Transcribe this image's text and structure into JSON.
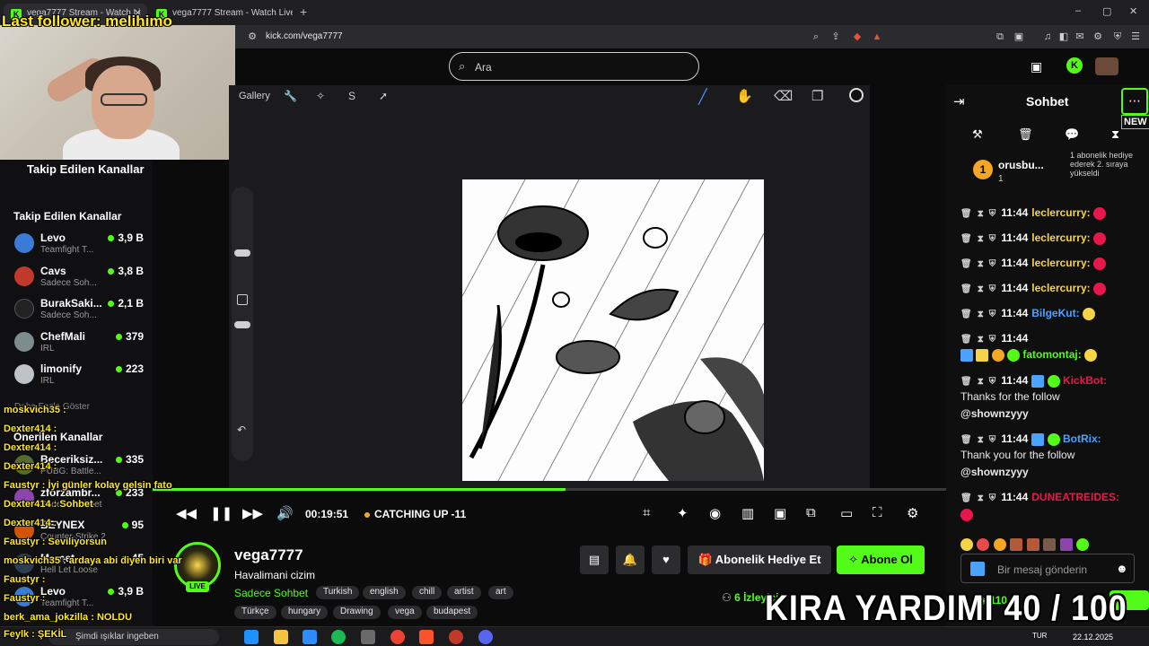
{
  "browser": {
    "tabs": [
      {
        "label": "vega7777 Stream - Watch Li"
      },
      {
        "label": "vega7777 Stream - Watch Live on Ki"
      }
    ],
    "new_tab": "+",
    "url": "kick.com/vega7777",
    "window_controls": [
      "–",
      "▢",
      "✕"
    ]
  },
  "overlay": {
    "last_follower": "Last follower: melihimo",
    "kira": "KIRA YARDIMI  40 / 100",
    "chat": [
      {
        "user": "moskvich35 :",
        "text": "",
        "color": "#ffe81f"
      },
      {
        "user": "Dexter414 :",
        "text": "",
        "color": "#ffe81f"
      },
      {
        "user": "Dexter414 :",
        "text": "",
        "color": "#ffe81f"
      },
      {
        "user": "Dexter414 :",
        "text": "",
        "color": "#ffe81f"
      },
      {
        "user": "Faustyr :",
        "text": "İyi günler kolay gelsin fato",
        "color": "#ffe81f"
      },
      {
        "user": "Dexter414 :",
        "text": "Sohbet",
        "color": "#ffe81f"
      },
      {
        "user": "Dexter414 :",
        "text": "",
        "color": "#ffe81f"
      },
      {
        "user": "Faustyr :",
        "text": "Seviliyorsun",
        "color": "#ffe81f"
      },
      {
        "user": "moskvich35 :",
        "text": "ardaya abi diyen biri var",
        "color": "#ffe81f"
      },
      {
        "user": "Faustyr :",
        "text": "",
        "color": "#ffe81f"
      },
      {
        "user": "Faustyr :",
        "text": "",
        "color": "#ffe81f"
      },
      {
        "user": "berk_ama_jokzilla :",
        "text": "NOLDU",
        "color": "#ffe81f"
      },
      {
        "user": "Feylk :",
        "text": "ŞEKİL",
        "color": "#ffe81f"
      }
    ]
  },
  "sidebar": {
    "heading_followed_top": "Takip Edilen Kanallar",
    "heading_followed": "Takip Edilen Kanallar",
    "heading_recommended": "Önerilen Kanallar",
    "show_more": "Daha Fazla Göster",
    "followed": [
      {
        "name": "Levo",
        "sub": "Teamfight T...",
        "viewers": "3,9 B",
        "color": "#3a7bd5"
      },
      {
        "name": "Cavs",
        "sub": "Sadece Soh...",
        "viewers": "3,8 B",
        "color": "#c0392b"
      },
      {
        "name": "BurakSaki...",
        "sub": "Sadece Soh...",
        "viewers": "2,1 B",
        "color": "#222222"
      },
      {
        "name": "ChefMali",
        "sub": "IRL",
        "viewers": "379",
        "color": "#7f8c8d"
      },
      {
        "name": "limonify",
        "sub": "IRL",
        "viewers": "223",
        "color": "#bdc3c7"
      }
    ],
    "recommended": [
      {
        "name": "Beceriksiz...",
        "sub": "PUBG: Battle...",
        "viewers": "335"
      },
      {
        "name": "zforzambr...",
        "sub": "Sadece Sohbet",
        "viewers": "233"
      },
      {
        "name": "BEYNEX",
        "sub": "Counter-Strike 2",
        "viewers": "95"
      },
      {
        "name": "Memet",
        "sub": "Hell Let Loose",
        "viewers": "45"
      },
      {
        "name": "Levo",
        "sub": "Teamfight T...",
        "viewers": "3,9 B"
      }
    ]
  },
  "header": {
    "search_placeholder": "Ara"
  },
  "player": {
    "gallery": "Gallery",
    "time": "00:19:51",
    "status": "CATCHING UP -11",
    "progress": 0.52
  },
  "stream": {
    "streamer": "vega7777",
    "live": "LIVE",
    "title": "Havalimani cizim",
    "category": "Sadece Sohbet",
    "tags_row1": [
      "Turkish",
      "english",
      "chill",
      "artist",
      "art"
    ],
    "tags_row2": [
      "Türkçe",
      "hungary",
      "Drawing",
      "vega",
      "budapest"
    ],
    "gift_label": "Abonelik Hediye Et",
    "subscribe_label": "Abone Ol",
    "viewers": "6 İzleyici"
  },
  "chat": {
    "title": "Sohbet",
    "new_badge": "NEW",
    "pinned_user": "orusbu...",
    "pinned_count": "1",
    "pinned_text": "1 abonelik hediye ederek 2. sıraya yükseldi",
    "messages": [
      {
        "time": "11:44",
        "user": "leclercurry:",
        "color": "#f5d547",
        "emote": "#e8174a"
      },
      {
        "time": "11:44",
        "user": "leclercurry:",
        "color": "#f5d547",
        "emote": "#e8174a"
      },
      {
        "time": "11:44",
        "user": "leclercurry:",
        "color": "#f5d547",
        "emote": "#e8174a"
      },
      {
        "time": "11:44",
        "user": "leclercurry:",
        "color": "#f5d547",
        "emote": "#e8174a"
      },
      {
        "time": "11:44",
        "user": "BilgeKut:",
        "color": "#4aa3ff",
        "emote": "#f5d547"
      }
    ],
    "fatomontaj_time": "11:44",
    "fatomontaj_user": "fatomontaj:",
    "kickbot_time": "11:44",
    "kickbot_user": "KickBot:",
    "kickbot_text1": "Thanks for the follow",
    "kickbot_text2": "@shownzyyy",
    "botrix_time": "11:44",
    "botrix_user": "BotRix:",
    "botrix_text1": "Thank you for the follow",
    "botrix_text2": "@shownzyyy",
    "dune_time": "11:44",
    "dune_user": "DUNEATREIDES:",
    "input_placeholder": "Bir mesaj gönderin",
    "points": "110"
  },
  "taskbar": {
    "search": "Şimdi ışıklar ingeben",
    "lang": "TUR",
    "time": "22.12.2025"
  }
}
